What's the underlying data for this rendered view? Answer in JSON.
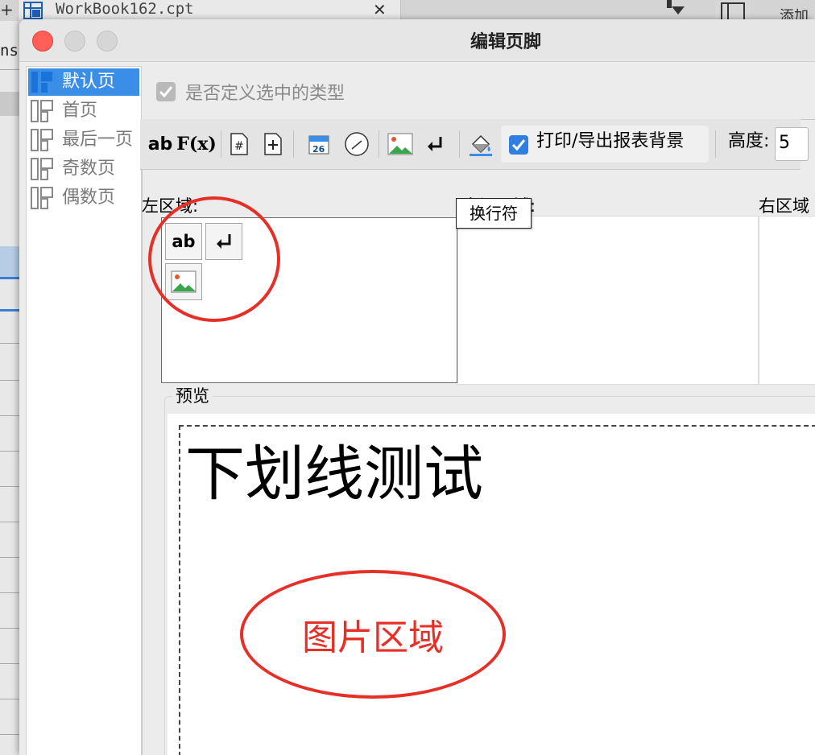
{
  "background_window": {
    "plus_glyph": "+",
    "tab_title": "WorkBook162.cpt",
    "tab_close": "✕",
    "add_text": "添加",
    "left_fragment": "ns"
  },
  "dialog": {
    "title": "编辑页脚",
    "page_list": [
      {
        "label": "默认页",
        "selected": true
      },
      {
        "label": "首页",
        "selected": false
      },
      {
        "label": "最后一页",
        "selected": false
      },
      {
        "label": "奇数页",
        "selected": false
      },
      {
        "label": "偶数页",
        "selected": false
      }
    ],
    "define_checkbox_label": "是否定义选中的类型",
    "toolbar": {
      "text_button": "ab",
      "formula_button": "F(x)",
      "print_checkbox_label": "打印/导出报表背景",
      "height_label": "高度:",
      "height_value": "5"
    },
    "regions": {
      "left_label": "左区域:",
      "center_label": "中间区域:",
      "right_label": "右区域"
    },
    "left_region_items": {
      "text_item": "ab"
    },
    "tooltip": "换行符",
    "preview": {
      "legend": "预览",
      "text": "下划线测试",
      "image_area_label": "图片区域"
    }
  },
  "colors": {
    "selection": "#3a8ee6",
    "annotation": "#e63027",
    "close_button": "#ff5f57"
  }
}
